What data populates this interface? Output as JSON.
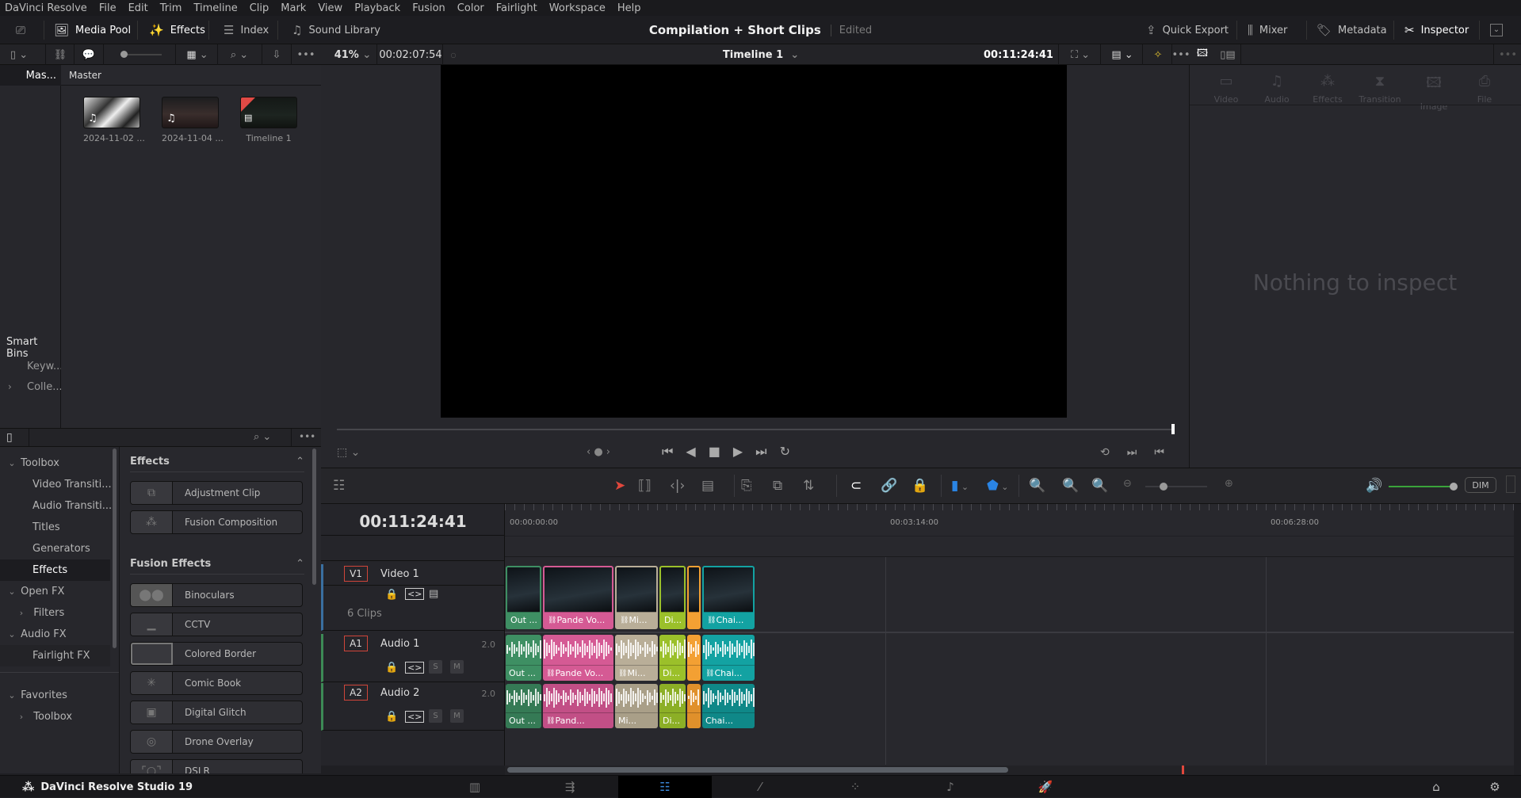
{
  "menu": [
    "DaVinci Resolve",
    "File",
    "Edit",
    "Trim",
    "Timeline",
    "Clip",
    "Mark",
    "View",
    "Playback",
    "Fusion",
    "Color",
    "Fairlight",
    "Workspace",
    "Help"
  ],
  "header": {
    "left_buttons": [
      {
        "label": "Media Pool",
        "icon": "media-pool-icon",
        "active": true
      },
      {
        "label": "Effects",
        "icon": "effects-wand-icon",
        "active": true
      },
      {
        "label": "Index",
        "icon": "index-list-icon",
        "active": false
      },
      {
        "label": "Sound Library",
        "icon": "sound-library-icon",
        "active": false
      }
    ],
    "project_title": "Compilation + Short Clips",
    "project_status": "Edited",
    "right_buttons": [
      {
        "label": "Quick Export",
        "icon": "export-icon",
        "active": false
      },
      {
        "label": "Mixer",
        "icon": "mixer-icon",
        "active": false
      },
      {
        "label": "Metadata",
        "icon": "metadata-tag-icon",
        "active": false
      },
      {
        "label": "Inspector",
        "icon": "inspector-icon",
        "active": true
      }
    ]
  },
  "viewer": {
    "zoom": "41%",
    "source_timecode": "00:02:07:54",
    "timeline_name": "Timeline 1",
    "record_timecode": "00:11:24:41"
  },
  "bins": {
    "selected": "Mas...",
    "smart_bins_label": "Smart Bins",
    "smart_items": [
      {
        "label": "Keyw...",
        "expandable": false
      },
      {
        "label": "Colle...",
        "expandable": true
      }
    ]
  },
  "media_pool": {
    "current_bin": "Master",
    "items": [
      {
        "label": "2024-11-02 ...",
        "type": "audio-video"
      },
      {
        "label": "2024-11-04 ...",
        "type": "audio-video"
      },
      {
        "label": "Timeline 1",
        "type": "timeline"
      }
    ]
  },
  "effects_tree": [
    {
      "label": "Toolbox",
      "level": 0,
      "expanded": true
    },
    {
      "label": "Video Transiti...",
      "level": 1
    },
    {
      "label": "Audio Transiti...",
      "level": 1
    },
    {
      "label": "Titles",
      "level": 1
    },
    {
      "label": "Generators",
      "level": 1
    },
    {
      "label": "Effects",
      "level": 1,
      "selected": true
    },
    {
      "label": "Open FX",
      "level": 0,
      "expanded": true
    },
    {
      "label": "Filters",
      "level": 1,
      "expandable": true
    },
    {
      "label": "Audio FX",
      "level": 0,
      "expanded": true
    },
    {
      "label": "Fairlight FX",
      "level": 1
    }
  ],
  "favorites": [
    {
      "label": "Favorites",
      "level": 0,
      "expanded": true
    },
    {
      "label": "Toolbox",
      "level": 1,
      "expandable": true
    }
  ],
  "effects_list": {
    "sections": [
      {
        "title": "Effects",
        "items": [
          "Adjustment Clip",
          "Fusion Composition"
        ]
      },
      {
        "title": "Fusion Effects",
        "items": [
          "Binoculars",
          "CCTV",
          "Colored Border",
          "Comic Book",
          "Digital Glitch",
          "Drone Overlay",
          "DSLR"
        ]
      }
    ]
  },
  "inspector": {
    "tabs": [
      "Video",
      "Audio",
      "Effects",
      "Transition",
      "Image",
      "File"
    ],
    "empty_message": "Nothing to inspect"
  },
  "timeline": {
    "current_timecode": "00:11:24:41",
    "ruler_labels": [
      "00:00:00:00",
      "00:03:14:00",
      "00:06:28:00"
    ],
    "audio_monitor_level": 1.0,
    "dim_label": "DIM",
    "tracks": [
      {
        "id": "V1",
        "name": "Video 1",
        "info": "6 Clips",
        "type": "video",
        "clips": [
          {
            "label": "Out ...",
            "color": "#3e8f63",
            "linked": false
          },
          {
            "label": "Pande Vo...",
            "color": "#d55a94",
            "linked": true
          },
          {
            "label": "Mi...",
            "color": "#b9ae98",
            "linked": true
          },
          {
            "label": "Di...",
            "color": "#9bc02a",
            "linked": false
          },
          {
            "label": "",
            "color": "#f3a033",
            "linked": false
          },
          {
            "label": "Chai...",
            "color": "#13a2a2",
            "linked": true
          }
        ]
      },
      {
        "id": "A1",
        "name": "Audio 1",
        "channels": "2.0",
        "type": "audio",
        "clips": [
          {
            "label": "Out ...",
            "color": "#3e8f63",
            "linked": false
          },
          {
            "label": "Pande Vo...",
            "color": "#d55a94",
            "linked": true
          },
          {
            "label": "Mi...",
            "color": "#b9ae98",
            "linked": true
          },
          {
            "label": "Di...",
            "color": "#9bc02a",
            "linked": false
          },
          {
            "label": "",
            "color": "#f3a033",
            "linked": false
          },
          {
            "label": "Chai...",
            "color": "#13a2a2",
            "linked": true
          }
        ]
      },
      {
        "id": "A2",
        "name": "Audio 2",
        "channels": "2.0",
        "type": "audio",
        "clips": [
          {
            "label": "Out ...",
            "color": "#357a55",
            "linked": false
          },
          {
            "label": "Pand...",
            "color": "#c24f86",
            "linked": true
          },
          {
            "label": "Mi...",
            "color": "#a99f88",
            "linked": false
          },
          {
            "label": "Di...",
            "color": "#8caf26",
            "linked": false
          },
          {
            "label": "",
            "color": "#e0902b",
            "linked": false
          },
          {
            "label": "Chai...",
            "color": "#0f8888",
            "linked": false
          }
        ]
      }
    ],
    "solo_label": "S",
    "mute_label": "M"
  },
  "pages": [
    "media",
    "cut",
    "edit",
    "fusion",
    "color",
    "fairlight",
    "deliver"
  ],
  "active_page": "edit",
  "app_name": "DaVinci Resolve Studio 19"
}
